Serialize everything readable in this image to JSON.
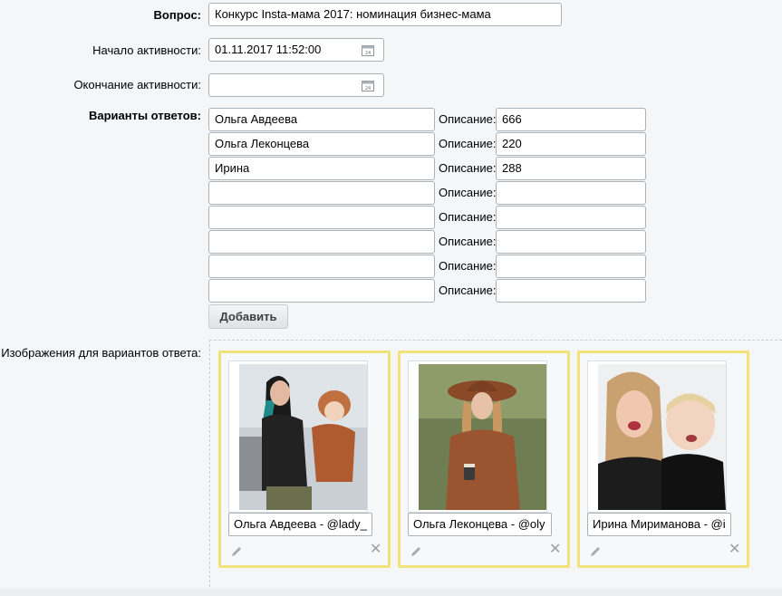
{
  "form": {
    "question_label": "Вопрос:",
    "question_value": "Конкурс Insta-мама 2017: номинация бизнес-мама",
    "start_label": "Начало активности:",
    "start_value": "01.11.2017 11:52:00",
    "end_label": "Окончание активности:",
    "end_value": "",
    "answers_label": "Варианты ответов:",
    "description_label": "Описание:",
    "answers": [
      {
        "name": "Ольга Авдеева",
        "description": "666"
      },
      {
        "name": "Ольга Леконцева",
        "description": "220"
      },
      {
        "name": "Ирина",
        "description": "288"
      },
      {
        "name": "",
        "description": ""
      },
      {
        "name": "",
        "description": ""
      },
      {
        "name": "",
        "description": ""
      },
      {
        "name": "",
        "description": ""
      },
      {
        "name": "",
        "description": ""
      }
    ],
    "add_button": "Добавить",
    "images_label": "Изображения для вариантов ответа:"
  },
  "images": [
    {
      "caption": "Ольга Авдеева - @lady_",
      "icon": "photo-woman-child-jacket"
    },
    {
      "caption": "Ольга Леконцева - @oly",
      "icon": "photo-woman-hat"
    },
    {
      "caption": "Ирина Мириманова - @i",
      "icon": "photo-woman-child"
    }
  ],
  "colors": {
    "card_border": "#f1e27a",
    "input_border": "#a9b1b9",
    "background": "#f5f6f7"
  }
}
